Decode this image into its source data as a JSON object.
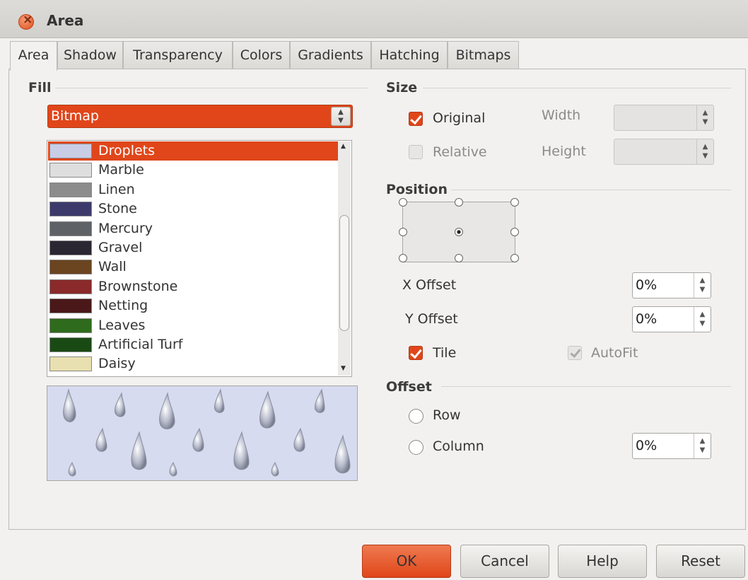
{
  "window": {
    "title": "Area"
  },
  "tabs": [
    "Area",
    "Shadow",
    "Transparency",
    "Colors",
    "Gradients",
    "Hatching",
    "Bitmaps"
  ],
  "fill": {
    "section_title": "Fill",
    "type_value": "Bitmap",
    "items": [
      {
        "label": "Droplets",
        "color": "#c9cde6"
      },
      {
        "label": "Marble",
        "color": "#dedede"
      },
      {
        "label": "Linen",
        "color": "#8c8c8c"
      },
      {
        "label": "Stone",
        "color": "#3c3a6b"
      },
      {
        "label": "Mercury",
        "color": "#5e6266"
      },
      {
        "label": "Gravel",
        "color": "#2a2632"
      },
      {
        "label": "Wall",
        "color": "#6b4420"
      },
      {
        "label": "Brownstone",
        "color": "#8a2a2a"
      },
      {
        "label": "Netting",
        "color": "#4a1818"
      },
      {
        "label": "Leaves",
        "color": "#2f6b1c"
      },
      {
        "label": "Artificial Turf",
        "color": "#1a4a14"
      },
      {
        "label": "Daisy",
        "color": "#e8e0b0"
      }
    ],
    "selected_index": 0
  },
  "size": {
    "section_title": "Size",
    "original_label": "Original",
    "original_checked": true,
    "relative_label": "Relative",
    "relative_checked": false,
    "width_label": "Width",
    "height_label": "Height"
  },
  "position": {
    "section_title": "Position",
    "x_offset_label": "X Offset",
    "x_offset_value": "0%",
    "y_offset_label": "Y Offset",
    "y_offset_value": "0%",
    "tile_label": "Tile",
    "tile_checked": true,
    "autofit_label": "AutoFit",
    "autofit_checked": true
  },
  "offset": {
    "section_title": "Offset",
    "row_label": "Row",
    "column_label": "Column",
    "column_value": "0%"
  },
  "buttons": {
    "ok": "OK",
    "cancel": "Cancel",
    "help": "Help",
    "reset": "Reset"
  },
  "colors": {
    "accent": "#e0461a",
    "background": "#f2f1f0"
  }
}
